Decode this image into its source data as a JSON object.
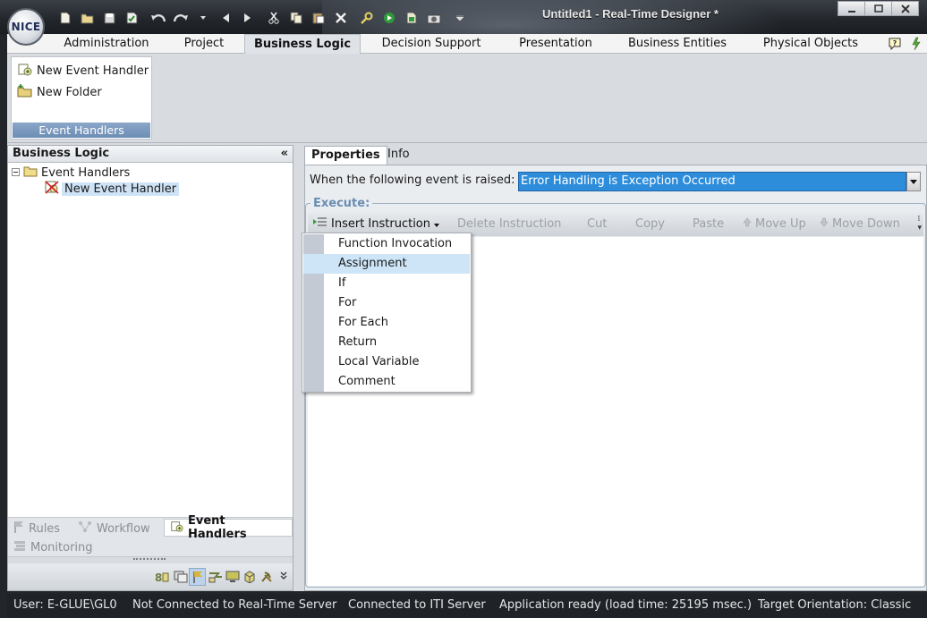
{
  "window": {
    "logo_text": "NICE",
    "title": "Untitled1 - Real-Time Designer *",
    "controls": [
      "minimize-icon",
      "maximize-icon",
      "close-icon"
    ]
  },
  "quick_access": [
    "new-icon",
    "open-icon",
    "save-icon",
    "save-all-icon",
    "undo-icon",
    "redo-icon",
    "back-icon",
    "forward-icon",
    "cut-icon",
    "copy-icon",
    "paste-icon",
    "delete-icon",
    "search-icon",
    "run-icon",
    "build-icon",
    "camera-icon",
    "customize-icon"
  ],
  "menu": {
    "tabs": [
      "Administration",
      "Project",
      "Business Logic",
      "Decision Support",
      "Presentation",
      "Business Entities",
      "Physical Objects"
    ],
    "active": "Business Logic",
    "right_icons": [
      "help-icon",
      "pin-icon"
    ]
  },
  "ribbon": {
    "buttons": [
      "New Event Handler",
      "New Folder"
    ],
    "group_label": "Event Handlers"
  },
  "left_panel": {
    "title": "Business Logic",
    "collapse": "«",
    "tree": {
      "root": "Event Handlers",
      "child": "New Event Handler"
    },
    "tabs": [
      "Rules",
      "Workflow",
      "Event Handlers",
      "Monitoring"
    ],
    "active_tab": "Event Handlers",
    "iconbar": [
      "variables-icon",
      "screens-icon",
      "flag-icon",
      "connectors-icon",
      "monitor-icon",
      "cube-icon",
      "tools-icon",
      "more-icon"
    ]
  },
  "right_panel": {
    "tabs": [
      "Properties",
      "Info"
    ],
    "active_tab": "Properties",
    "event_label": "When the following event is raised:",
    "event_value": "Error Handling is Exception Occurred",
    "execute_label": "Execute:",
    "toolbar": {
      "insert": "Insert Instruction",
      "delete": "Delete Instruction",
      "cut": "Cut",
      "copy": "Copy",
      "paste": "Paste",
      "move_up": "Move Up",
      "move_down": "Move Down"
    },
    "dropdown": {
      "items": [
        "Function Invocation",
        "Assignment",
        "If",
        "For",
        "For Each",
        "Return",
        "Local Variable",
        "Comment"
      ],
      "highlighted": "Assignment"
    }
  },
  "status": {
    "user": "User: E-GLUE\\GL0",
    "rt_server": "Not Connected to Real-Time Server",
    "iti": "Connected to ITI Server",
    "app": "Application ready (load time: 25195 msec.)",
    "orientation": "Target Orientation: Classic"
  }
}
